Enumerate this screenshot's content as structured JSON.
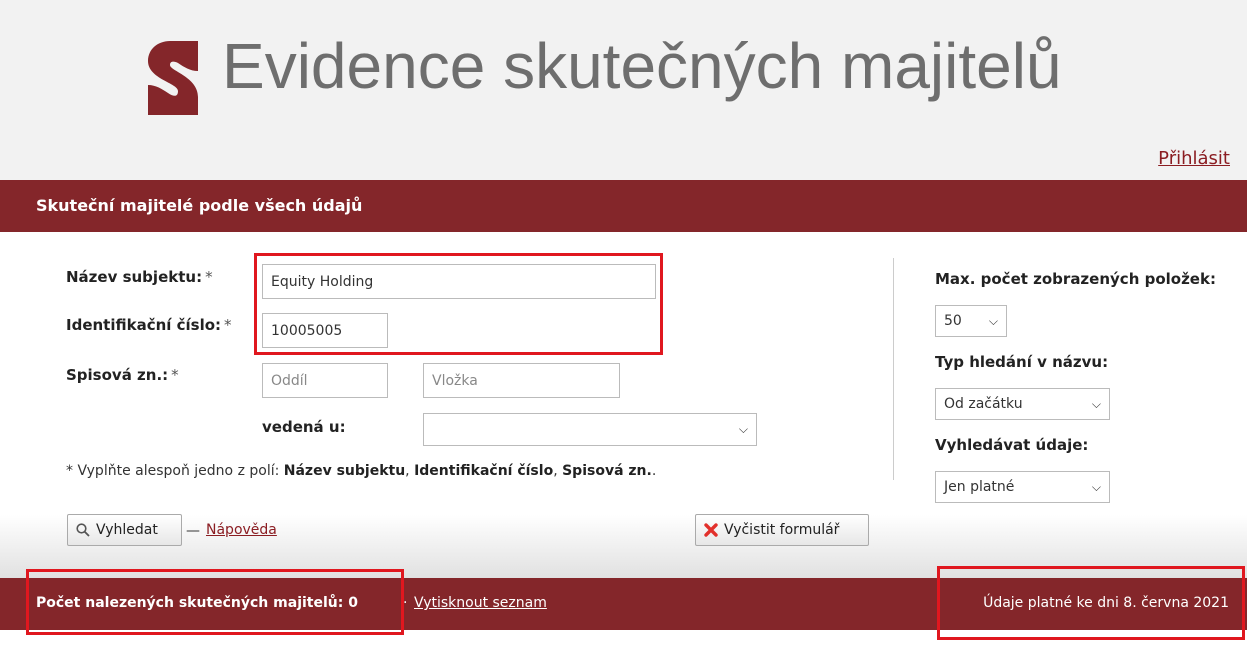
{
  "header": {
    "title": "Evidence skutečných majitelů",
    "login": "Přihlásit",
    "brand_color": "#84262a"
  },
  "section": {
    "title": "Skuteční majitelé podle všech údajů"
  },
  "form": {
    "subject_name_label": "Název subjektu:",
    "subject_name_value": "Equity Holding",
    "id_label": "Identifikační číslo:",
    "id_value": "10005005",
    "file_label": "Spisová zn.:",
    "section_placeholder": "Oddíl",
    "insert_placeholder": "Vložka",
    "court_label": "vedená u:",
    "court_value": "",
    "required_mark": "*",
    "hint_prefix": "* Vyplňte alespoň jedno z polí: ",
    "hint_field_1": "Název subjektu",
    "hint_comma_1": ", ",
    "hint_field_2": "Identifikační číslo",
    "hint_comma_2": ", ",
    "hint_field_3": "Spisová zn.",
    "hint_suffix": "."
  },
  "options": {
    "max_items_label": "Max. počet zobrazených položek:",
    "max_items_value": "50",
    "search_type_label": "Typ hledání v názvu:",
    "search_type_value": "Od začátku",
    "search_data_label": "Vyhledávat údaje:",
    "search_data_value": "Jen platné"
  },
  "actions": {
    "search": "Vyhledat",
    "help_sep": "—",
    "help": "Nápověda",
    "clear": "Vyčistit formulář"
  },
  "results": {
    "count_label": "Počet nalezených skutečných majitelů: 0",
    "sep": "·",
    "print": "Vytisknout seznam",
    "valid_date": "Údaje platné ke dni 8. června 2021"
  },
  "highlight_color": "#e0171f"
}
